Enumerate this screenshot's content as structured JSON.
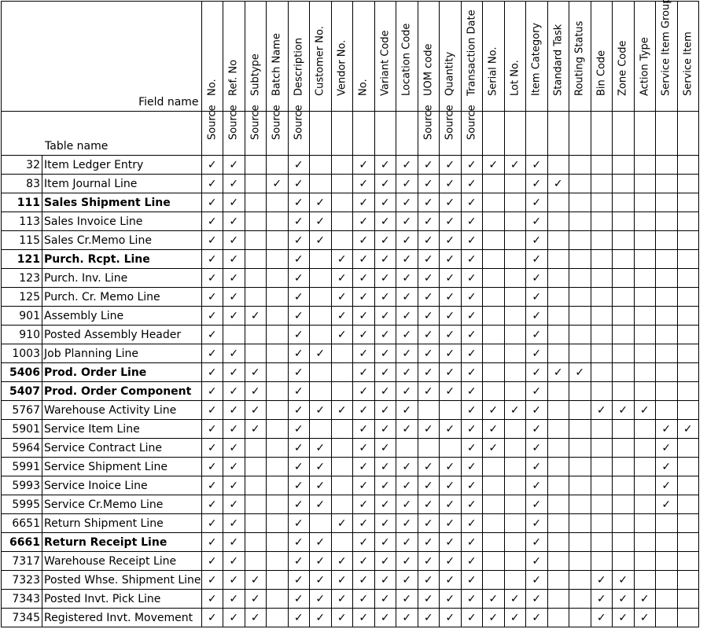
{
  "header": {
    "field_name_label": "Field name",
    "table_name_label": "Table name"
  },
  "columns": [
    {
      "field": "No.",
      "prefix": "Source"
    },
    {
      "field": "Ref. No",
      "prefix": "Source"
    },
    {
      "field": "Subtype",
      "prefix": "Source"
    },
    {
      "field": "Batch Name",
      "prefix": "Source"
    },
    {
      "field": "Description",
      "prefix": "Source"
    },
    {
      "field": "Customer No.",
      "prefix": ""
    },
    {
      "field": "Vendor No.",
      "prefix": ""
    },
    {
      "field": "No.",
      "prefix": ""
    },
    {
      "field": "Variant Code",
      "prefix": ""
    },
    {
      "field": "Location Code",
      "prefix": ""
    },
    {
      "field": "UOM code",
      "prefix": "Source"
    },
    {
      "field": "Quantity",
      "prefix": "Source"
    },
    {
      "field": "Transaction Date",
      "prefix": "Source"
    },
    {
      "field": "Serial No.",
      "prefix": ""
    },
    {
      "field": "Lot No.",
      "prefix": ""
    },
    {
      "field": "Item Category",
      "prefix": ""
    },
    {
      "field": "Standard Task",
      "prefix": ""
    },
    {
      "field": "Routing Status",
      "prefix": ""
    },
    {
      "field": "Bin Code",
      "prefix": ""
    },
    {
      "field": "Zone Code",
      "prefix": ""
    },
    {
      "field": "Action Type",
      "prefix": ""
    },
    {
      "field": "Service Item Group",
      "prefix": ""
    },
    {
      "field": "Service Item",
      "prefix": ""
    }
  ],
  "check_glyph": "✓",
  "rows": [
    {
      "id": "32",
      "name": "Item Ledger Entry",
      "bold": false,
      "checks": "11001001111111110000000"
    },
    {
      "id": "83",
      "name": "Item Journal Line",
      "bold": false,
      "checks": "11011001111110011000000"
    },
    {
      "id": "111",
      "name": "Sales Shipment Line",
      "bold": true,
      "checks": "11001101111110010000000"
    },
    {
      "id": "113",
      "name": "Sales Invoice Line",
      "bold": false,
      "checks": "11001101111110010000000"
    },
    {
      "id": "115",
      "name": "Sales Cr.Memo Line",
      "bold": false,
      "checks": "11001101111110010000000"
    },
    {
      "id": "121",
      "name": "Purch. Rcpt. Line",
      "bold": true,
      "checks": "11001011111110010000000"
    },
    {
      "id": "123",
      "name": "Purch. Inv. Line",
      "bold": false,
      "checks": "11001011111110010000000"
    },
    {
      "id": "125",
      "name": "Purch. Cr. Memo Line",
      "bold": false,
      "checks": "11001011111110010000000"
    },
    {
      "id": "901",
      "name": "Assembly Line",
      "bold": false,
      "checks": "11101011111110010000000"
    },
    {
      "id": "910",
      "name": "Posted Assembly Header",
      "bold": false,
      "checks": "10001011111110010000000"
    },
    {
      "id": "1003",
      "name": "Job Planning Line",
      "bold": false,
      "checks": "11001101111110010000000"
    },
    {
      "id": "5406",
      "name": "Prod. Order Line",
      "bold": true,
      "checks": "11101001111110011100000"
    },
    {
      "id": "5407",
      "name": "Prod. Order Component",
      "bold": true,
      "checks": "11101001111110010000000"
    },
    {
      "id": "5767",
      "name": "Warehouse Activity Line",
      "bold": false,
      "checks": "11101111110011110011100"
    },
    {
      "id": "5901",
      "name": "Service Item Line",
      "bold": false,
      "checks": "11101001111111010000011"
    },
    {
      "id": "5964",
      "name": "Service Contract Line",
      "bold": false,
      "checks": "11001101100011010000010"
    },
    {
      "id": "5991",
      "name": "Service Shipment Line",
      "bold": false,
      "checks": "11001101111110010000010"
    },
    {
      "id": "5993",
      "name": "Service Inoice Line",
      "bold": false,
      "checks": "11001101111110010000010"
    },
    {
      "id": "5995",
      "name": "Service Cr.Memo Line",
      "bold": false,
      "checks": "11001101111110010000010"
    },
    {
      "id": "6651",
      "name": "Return Shipment Line",
      "bold": false,
      "checks": "11001011111110010000000"
    },
    {
      "id": "6661",
      "name": "Return Receipt Line",
      "bold": true,
      "checks": "11001101111110010000000"
    },
    {
      "id": "7317",
      "name": "Warehouse Receipt Line",
      "bold": false,
      "checks": "11001111111110010000000"
    },
    {
      "id": "7323",
      "name": "Posted Whse. Shipment Line",
      "bold": false,
      "checks": "11101111111110010011000"
    },
    {
      "id": "7343",
      "name": "Posted Invt. Pick Line",
      "bold": false,
      "checks": "11101111111111110011100"
    },
    {
      "id": "7345",
      "name": "Registered Invt. Movement",
      "bold": false,
      "checks": "11101111111111110011100"
    }
  ]
}
